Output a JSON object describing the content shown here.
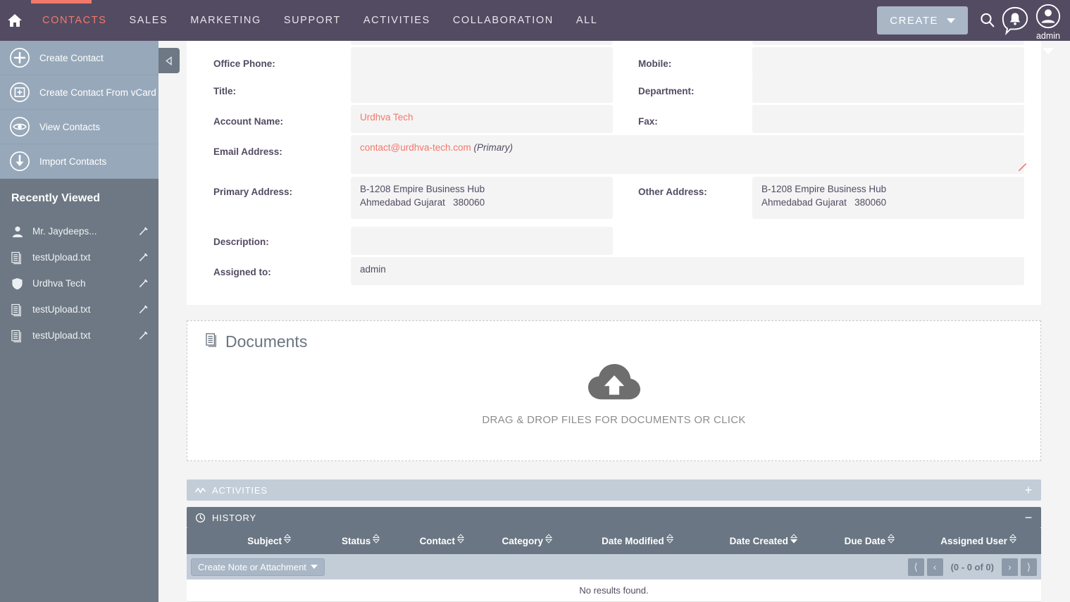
{
  "topnav": {
    "home_icon": "home-icon",
    "links": [
      {
        "label": "CONTACTS",
        "active": true
      },
      {
        "label": "SALES",
        "active": false
      },
      {
        "label": "MARKETING",
        "active": false
      },
      {
        "label": "SUPPORT",
        "active": false
      },
      {
        "label": "ACTIVITIES",
        "active": false
      },
      {
        "label": "COLLABORATION",
        "active": false
      },
      {
        "label": "ALL",
        "active": false
      }
    ],
    "create_label": "CREATE",
    "search_icon": "search-icon",
    "notifications_icon": "notification-bell-icon",
    "user_name": "admin",
    "accent_color": "#f2786b",
    "bar_color": "#534b62"
  },
  "sidebar": {
    "actions": [
      {
        "label": "Create Contact",
        "icon": "plus-circle-icon"
      },
      {
        "label": "Create Contact From vCard",
        "icon": "vcard-plus-icon"
      },
      {
        "label": "View Contacts",
        "icon": "eye-icon"
      },
      {
        "label": "Import Contacts",
        "icon": "download-arrow-icon"
      }
    ],
    "recent_title": "Recently Viewed",
    "recent_items": [
      {
        "label": "Mr. Jaydeeps...",
        "icon": "person-icon"
      },
      {
        "label": "testUpload.txt",
        "icon": "document-icon"
      },
      {
        "label": "Urdhva Tech",
        "icon": "shield-icon"
      },
      {
        "label": "testUpload.txt",
        "icon": "document-icon"
      },
      {
        "label": "testUpload.txt",
        "icon": "document-icon"
      }
    ],
    "collapse_icon": "collapse-left-icon"
  },
  "detail": {
    "fields": {
      "office_phone_label": "Office Phone:",
      "office_phone_value": "",
      "mobile_label": "Mobile:",
      "mobile_value": "",
      "title_label": "Title:",
      "title_value": "",
      "department_label": "Department:",
      "department_value": "",
      "account_name_label": "Account Name:",
      "account_name_value": "Urdhva Tech",
      "fax_label": "Fax:",
      "fax_value": "",
      "email_label": "Email Address:",
      "email_value": "contact@urdhva-tech.com",
      "email_primary_tag": "(Primary)",
      "primary_address_label": "Primary Address:",
      "primary_address_line1": "B-1208 Empire Business Hub",
      "primary_address_line2": "Ahmedabad Gujarat   380060",
      "other_address_label": "Other Address:",
      "other_address_line1": "B-1208 Empire Business Hub",
      "other_address_line2": "Ahmedabad Gujarat   380060",
      "description_label": "Description:",
      "description_value": "",
      "assigned_to_label": "Assigned to:",
      "assigned_to_value": "admin"
    },
    "inline_edit_icon": "pencil-icon"
  },
  "documents": {
    "title": "Documents",
    "title_icon": "document-icon",
    "upload_icon": "cloud-upload-icon",
    "dropzone_text": "DRAG & DROP FILES FOR DOCUMENTS OR CLICK"
  },
  "panels": {
    "activities": {
      "label": "ACTIVITIES",
      "icon": "activity-line-icon",
      "toggle": "+"
    },
    "history": {
      "label": "HISTORY",
      "icon": "clock-history-icon",
      "toggle": "−"
    }
  },
  "history_table": {
    "columns": [
      {
        "label": "Subject",
        "sorted": false
      },
      {
        "label": "Status",
        "sorted": false
      },
      {
        "label": "Contact",
        "sorted": false
      },
      {
        "label": "Category",
        "sorted": false
      },
      {
        "label": "Date Modified",
        "sorted": false
      },
      {
        "label": "Date Created",
        "sorted": "desc"
      },
      {
        "label": "Due Date",
        "sorted": false
      },
      {
        "label": "Assigned User",
        "sorted": false
      }
    ],
    "create_button_label": "Create Note or Attachment",
    "pager": {
      "first": "⟨",
      "prev": "‹",
      "count": "(0 - 0 of 0)",
      "next": "›",
      "last": "⟩"
    },
    "empty_message": "No results found."
  }
}
